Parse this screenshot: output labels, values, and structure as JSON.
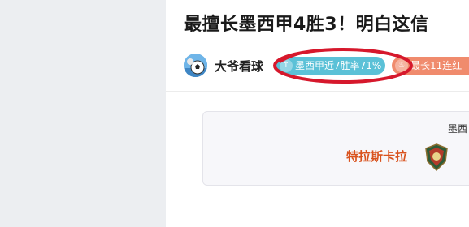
{
  "article": {
    "title": "最擅长墨西甲4胜3！明白这信"
  },
  "author": {
    "name": "大爷看球",
    "avatar_icon": "soccer-ball-avatar-icon"
  },
  "tags": [
    {
      "label": "墨西甲近7胜率71%",
      "icon": "arrow-up-icon",
      "color": "#5bc1d7"
    },
    {
      "label": "最长11连红",
      "icon": "flame-icon",
      "color": "#f08b6d"
    }
  ],
  "match": {
    "league": "墨西",
    "team": "特拉斯卡拉",
    "team_logo_icon": "team-crest-icon"
  },
  "annotation": {
    "color": "#d6182c"
  }
}
